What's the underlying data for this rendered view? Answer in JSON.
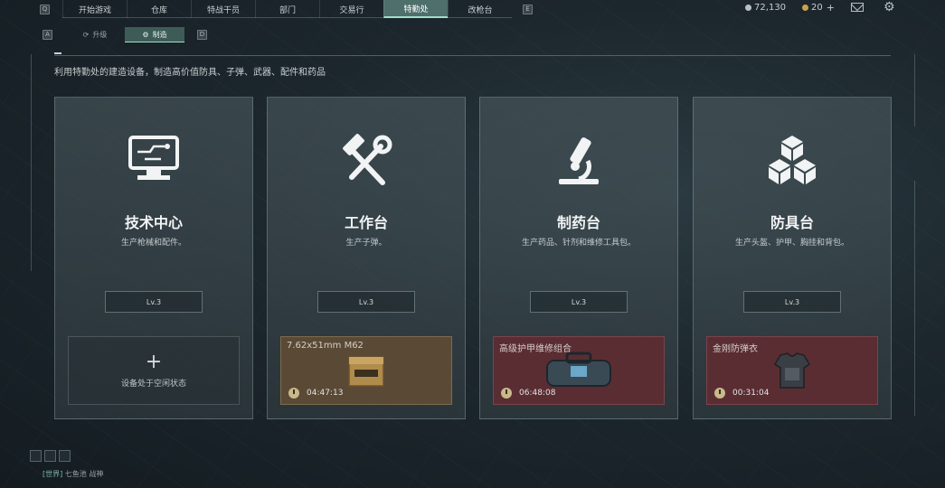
{
  "top_nav": {
    "left_key": "Q",
    "right_key": "E",
    "tabs": [
      {
        "label": "开始游戏"
      },
      {
        "label": "仓库"
      },
      {
        "label": "特战干员"
      },
      {
        "label": "部门"
      },
      {
        "label": "交易行"
      },
      {
        "label": "特勤处",
        "active": true
      },
      {
        "label": "改枪台"
      }
    ],
    "currency_1": "72,130",
    "currency_2": "20",
    "currency_2_plus": "+"
  },
  "sub_nav": {
    "left_key": "A",
    "right_key": "D",
    "tabs": [
      {
        "label": "升级"
      },
      {
        "label": "制造",
        "active": true
      }
    ]
  },
  "description": "利用特勤处的建造设备，制造高价值防具、子弹、武器、配件和药品",
  "cards": [
    {
      "title": "技术中心",
      "subtitle": "生产枪械和配件。",
      "level": "Lv.3",
      "slot_text": "设备处于空闲状态",
      "icon": "computer-icon"
    },
    {
      "title": "工作台",
      "subtitle": "生产子弹。",
      "level": "Lv.3",
      "item_name": "7.62x51mm M62",
      "timer": "04:47:13",
      "icon": "hammer-wrench-icon"
    },
    {
      "title": "制药台",
      "subtitle": "生产药品、针剂和维修工具包。",
      "level": "Lv.3",
      "item_name": "高级护甲维修组合",
      "timer": "06:48:08",
      "icon": "microscope-icon"
    },
    {
      "title": "防具台",
      "subtitle": "生产头盔、护甲、胸挂和背包。",
      "level": "Lv.3",
      "item_name": "金刚防弹衣",
      "timer": "00:31:04",
      "icon": "boxes-icon"
    }
  ],
  "chat": {
    "channel": "[世界]",
    "name": "七鱼池",
    "message": "战神"
  },
  "colors": {
    "accent": "#9fe0c5",
    "active_tab": "#4e6f6b",
    "gold_slot": "#5a4a35",
    "red_slot": "#5a2d33"
  }
}
